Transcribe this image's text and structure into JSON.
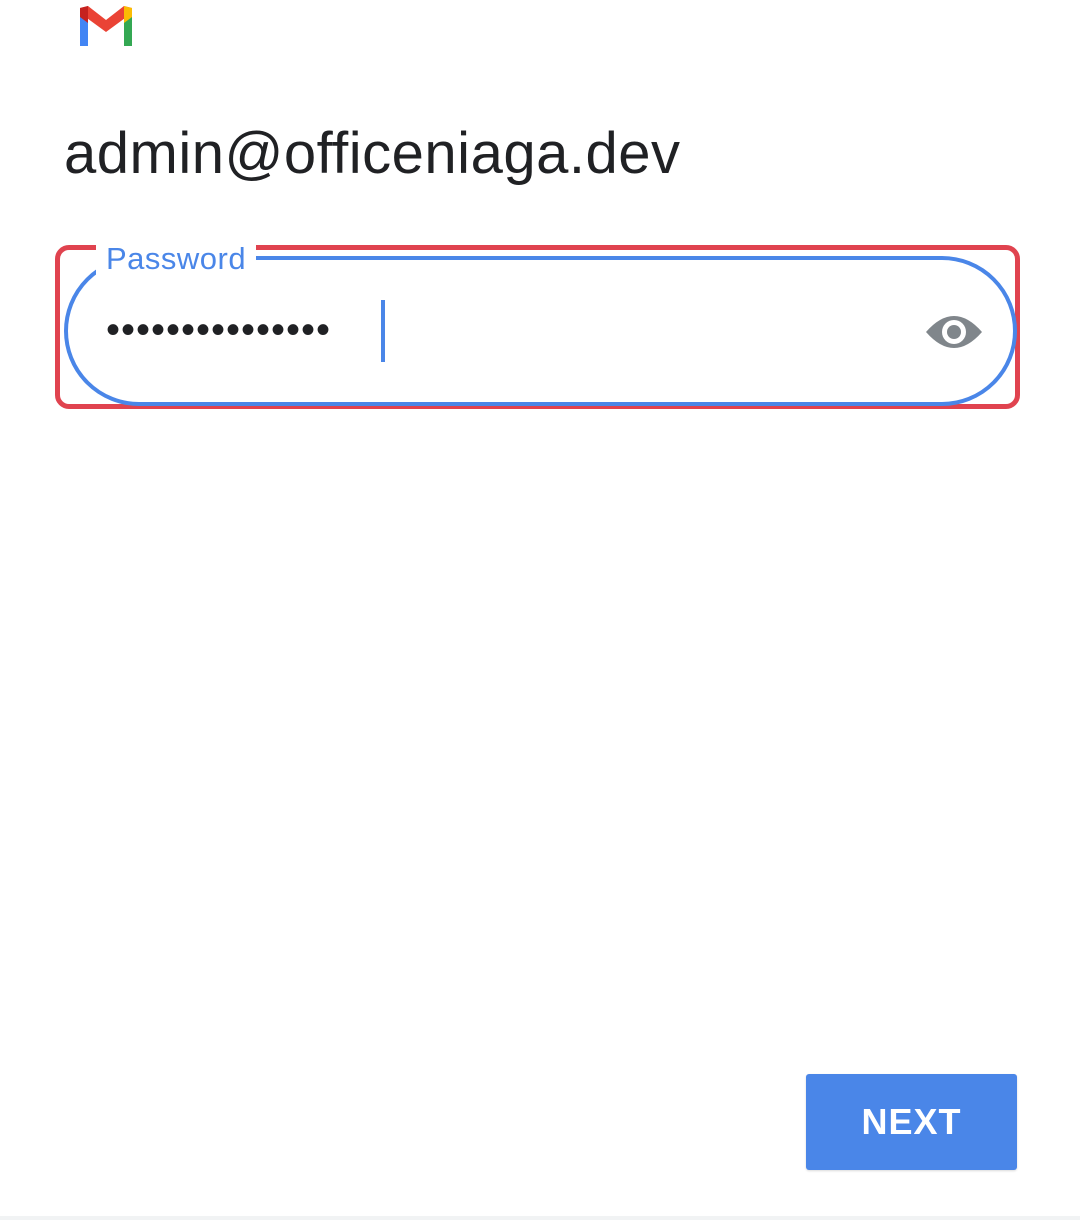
{
  "app": {
    "logo_icon": "gmail-logo-icon",
    "brand_colors": {
      "red": "#ea4335",
      "blue": "#4285f4",
      "green": "#34a853",
      "yellow": "#fbbc04",
      "dark_red": "#c5221f"
    }
  },
  "account": {
    "email": "admin@officeniaga.dev"
  },
  "password_field": {
    "label": "Password",
    "masked_value": "•••••••••••••••",
    "visibility_icon": "eye-icon",
    "focus_color": "#4a86e8",
    "highlight_color": "#e0434f"
  },
  "actions": {
    "next_label": "NEXT",
    "next_color": "#4a86e8"
  }
}
